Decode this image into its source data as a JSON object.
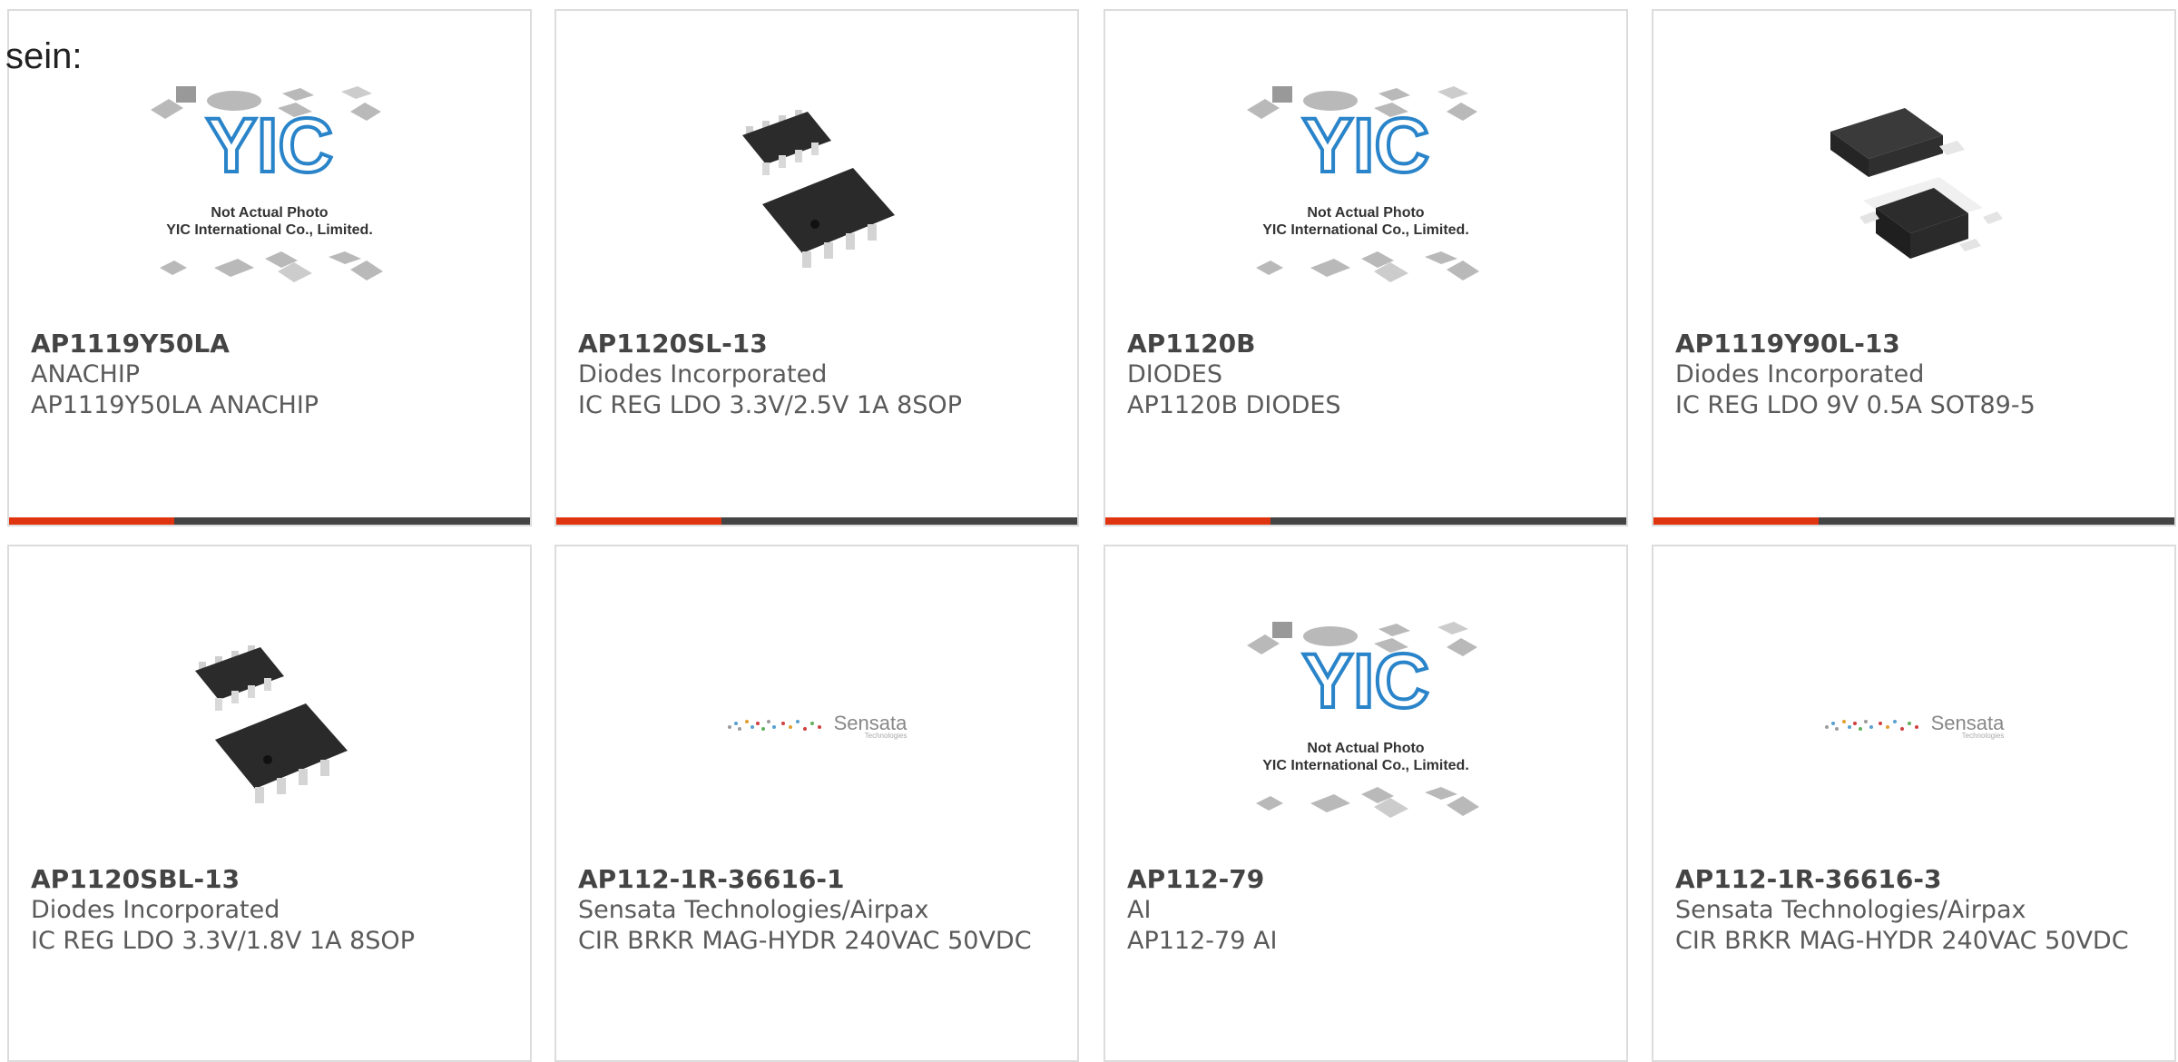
{
  "intro_text": "sein:",
  "placeholder": {
    "logo": "YIC",
    "line1": "Not Actual Photo",
    "line2": "YIC International Co., Limited."
  },
  "sensata": {
    "brand": "Sensata",
    "sub": "Technologies"
  },
  "colors": {
    "accent": "#e03410",
    "bar": "#444444",
    "border": "#dcdcdc"
  },
  "products": [
    {
      "part": "AP1119Y50LA",
      "manufacturer": "ANACHIP",
      "description": "AP1119Y50LA ANACHIP",
      "image": "yic-placeholder"
    },
    {
      "part": "AP1120SL-13",
      "manufacturer": "Diodes Incorporated",
      "description": "IC REG LDO 3.3V/2.5V 1A 8SOP",
      "image": "sop8-chip"
    },
    {
      "part": "AP1120B",
      "manufacturer": "DIODES",
      "description": "AP1120B DIODES",
      "image": "yic-placeholder"
    },
    {
      "part": "AP1119Y90L-13",
      "manufacturer": "Diodes Incorporated",
      "description": "IC REG LDO 9V 0.5A SOT89-5",
      "image": "sot89-chip"
    },
    {
      "part": "AP1120SBL-13",
      "manufacturer": "Diodes Incorporated",
      "description": "IC REG LDO 3.3V/1.8V 1A 8SOP",
      "image": "sop8-chip"
    },
    {
      "part": "AP112-1R-36616-1",
      "manufacturer": "Sensata Technologies/Airpax",
      "description": "CIR BRKR MAG-HYDR 240VAC 50VDC",
      "image": "sensata-logo"
    },
    {
      "part": "AP112-79",
      "manufacturer": "AI",
      "description": "AP112-79 AI",
      "image": "yic-placeholder"
    },
    {
      "part": "AP112-1R-36616-3",
      "manufacturer": "Sensata Technologies/Airpax",
      "description": "CIR BRKR MAG-HYDR 240VAC 50VDC",
      "image": "sensata-logo"
    }
  ]
}
